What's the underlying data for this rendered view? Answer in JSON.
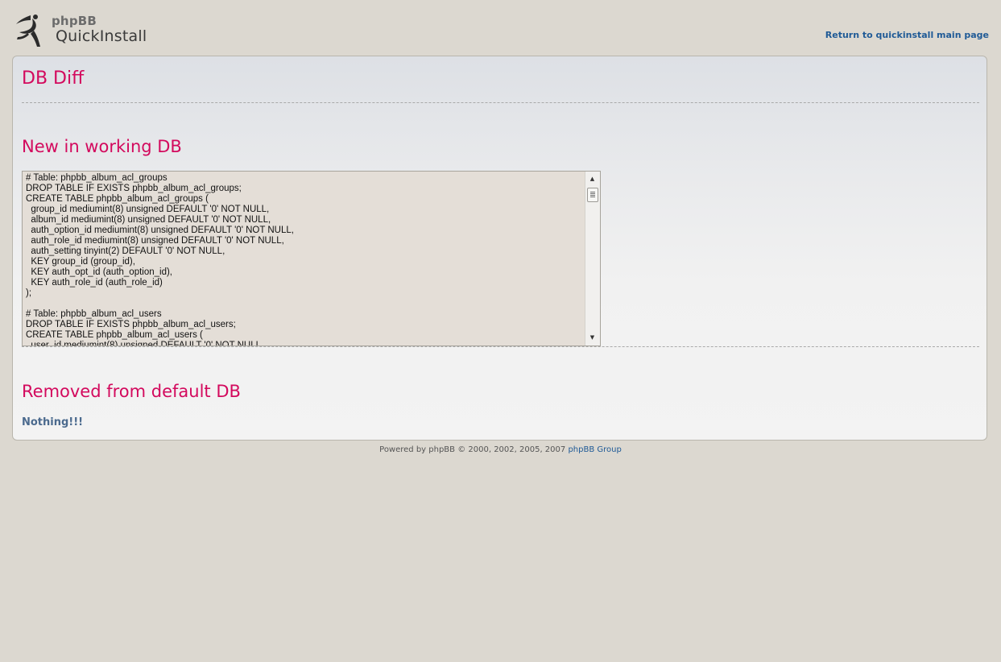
{
  "header": {
    "logo_small": "phpBB",
    "logo_large": "QuickInstall",
    "return_link": "Return to quickinstall main page"
  },
  "page": {
    "title": "DB Diff",
    "section_new": "New in working DB",
    "section_removed": "Removed from default DB",
    "removed_content": "Nothing!!!",
    "sql_text": "# Table: phpbb_album_acl_groups\nDROP TABLE IF EXISTS phpbb_album_acl_groups;\nCREATE TABLE phpbb_album_acl_groups (\n  group_id mediumint(8) unsigned DEFAULT '0' NOT NULL,\n  album_id mediumint(8) unsigned DEFAULT '0' NOT NULL,\n  auth_option_id mediumint(8) unsigned DEFAULT '0' NOT NULL,\n  auth_role_id mediumint(8) unsigned DEFAULT '0' NOT NULL,\n  auth_setting tinyint(2) DEFAULT '0' NOT NULL,\n  KEY group_id (group_id),\n  KEY auth_opt_id (auth_option_id),\n  KEY auth_role_id (auth_role_id)\n);\n\n# Table: phpbb_album_acl_users\nDROP TABLE IF EXISTS phpbb_album_acl_users;\nCREATE TABLE phpbb_album_acl_users (\n  user_id mediumint(8) unsigned DEFAULT '0' NOT NULL,"
  },
  "footer": {
    "text": "Powered by phpBB © 2000, 2002, 2005, 2007",
    "link": "phpBB Group"
  },
  "icons": {
    "logo": "runner-logo-icon",
    "scroll_up": "scroll-up-arrow-icon",
    "scroll_down": "scroll-down-arrow-icon"
  },
  "colors": {
    "heading": "#d3095d",
    "link": "#1f5a96",
    "background": "#dcd8d0"
  }
}
